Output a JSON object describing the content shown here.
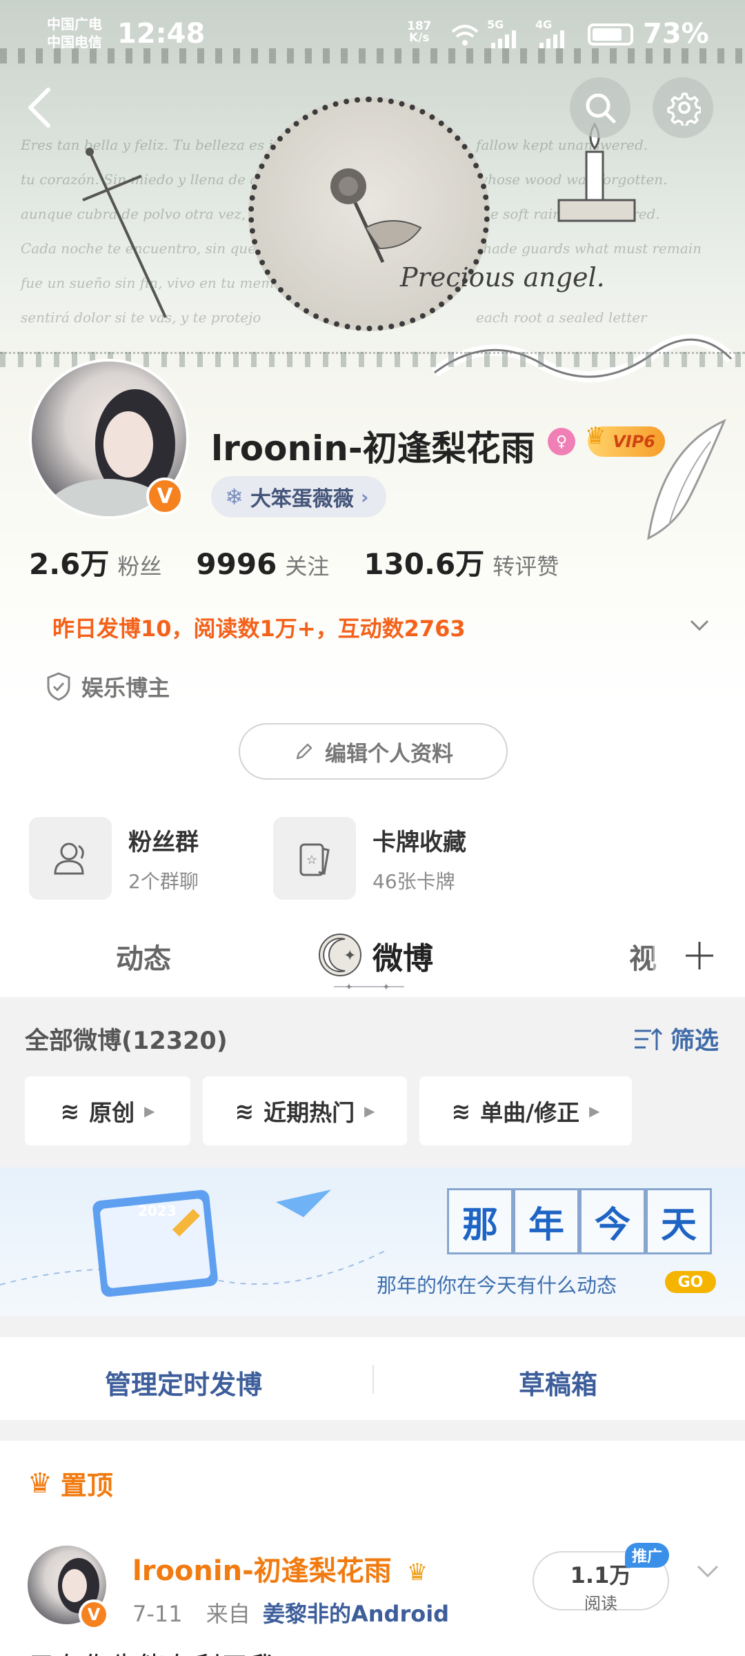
{
  "status_bar": {
    "carrier1": "中国广电",
    "carrier2": "中国电信",
    "time": "12:48",
    "net_speed_value": "187",
    "net_speed_unit": "K/s",
    "signal1": "5G",
    "signal2": "4G",
    "battery": "73%"
  },
  "banner": {
    "caption": "Precious angel."
  },
  "profile": {
    "name": "lroonin-初逢梨花雨",
    "vip_label": "VIP6",
    "fan_group_tag": "大笨蛋薇薇",
    "stats": [
      {
        "value": "2.6万",
        "label": "粉丝"
      },
      {
        "value": "9996",
        "label": "关注"
      },
      {
        "value": "130.6万",
        "label": "转评赞"
      }
    ],
    "yesterday_summary": "昨日发博10，阅读数1万+，互动数2763",
    "role": "娱乐博主",
    "edit_button": "编辑个人资料"
  },
  "cards": [
    {
      "title": "粉丝群",
      "subtitle": "2个群聊"
    },
    {
      "title": "卡牌收藏",
      "subtitle": "46张卡牌"
    }
  ],
  "tabs": {
    "items": [
      "动态",
      "微博",
      "视"
    ],
    "active": "微博"
  },
  "feed": {
    "all_label": "全部微博(12320)",
    "filter_label": "筛选",
    "chips": [
      "原创",
      "近期热门",
      "单曲/修正"
    ]
  },
  "promo": {
    "chars": [
      "那",
      "年",
      "今",
      "天"
    ],
    "subtitle": "那年的你在今天有什么动态",
    "go": "GO",
    "calendar_year": "2023"
  },
  "manage": {
    "scheduled": "管理定时发博",
    "drafts": "草稿箱"
  },
  "post": {
    "pinned_label": "置顶",
    "author": "lroonin-初逢梨花雨",
    "date": "7-11",
    "source_prefix": "来自",
    "source": "姜黎非的Android",
    "read_count": "1.1万",
    "read_label": "阅读",
    "promo_tag": "推广",
    "text_preview": "只有你先能有利于我"
  },
  "colors": {
    "accent_orange": "#f17b10",
    "link_blue": "#3d5e9b",
    "verified": "#f6811f"
  }
}
